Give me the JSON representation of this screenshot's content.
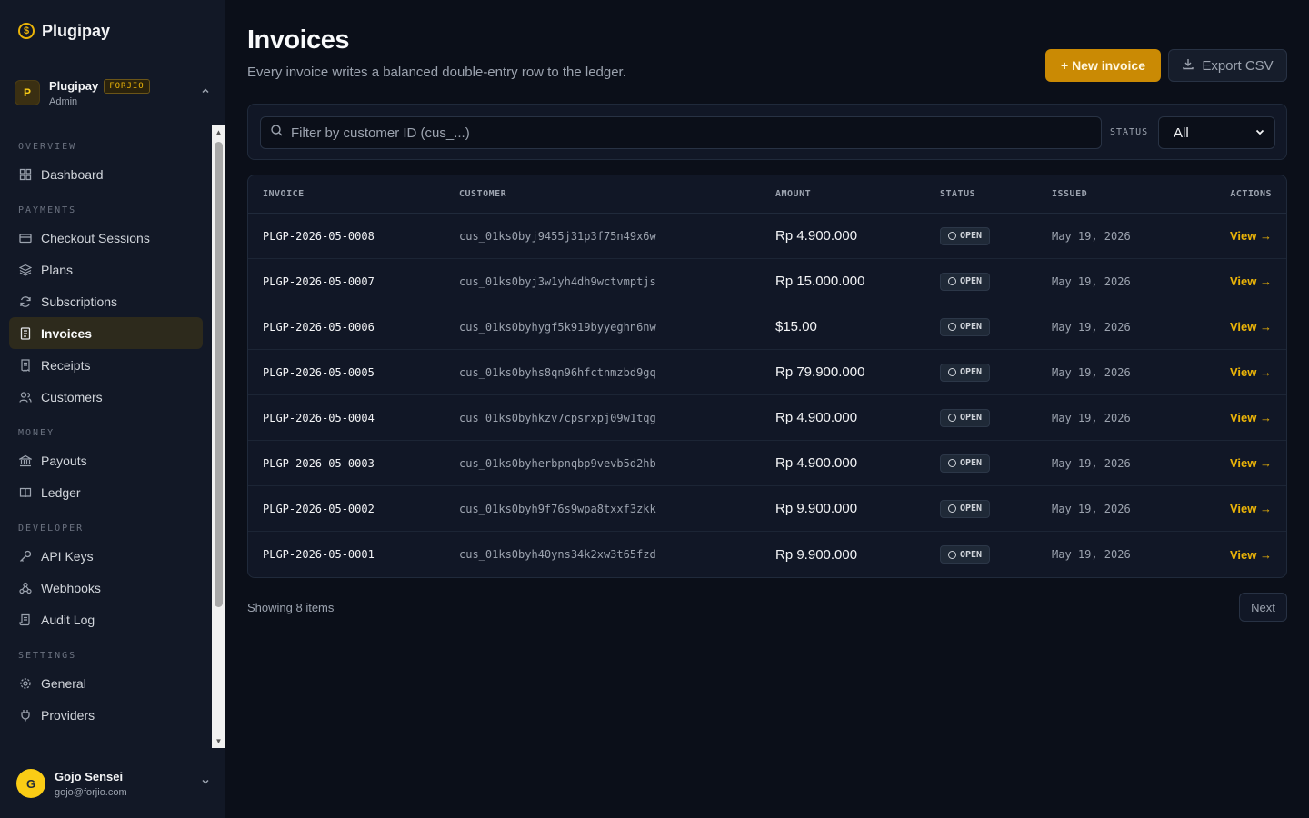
{
  "brand": {
    "name": "Plugipay",
    "logo_glyph": "$"
  },
  "org": {
    "initial": "P",
    "name": "Plugipay",
    "tag": "FORJIO",
    "role": "Admin"
  },
  "nav": {
    "sections": [
      {
        "title": "OVERVIEW",
        "items": [
          {
            "label": "Dashboard",
            "icon": "grid-icon"
          }
        ]
      },
      {
        "title": "PAYMENTS",
        "items": [
          {
            "label": "Checkout Sessions",
            "icon": "card-icon"
          },
          {
            "label": "Plans",
            "icon": "layers-icon"
          },
          {
            "label": "Subscriptions",
            "icon": "refresh-icon"
          },
          {
            "label": "Invoices",
            "icon": "invoice-icon",
            "active": true
          },
          {
            "label": "Receipts",
            "icon": "receipt-icon"
          },
          {
            "label": "Customers",
            "icon": "users-icon"
          }
        ]
      },
      {
        "title": "MONEY",
        "items": [
          {
            "label": "Payouts",
            "icon": "bank-icon"
          },
          {
            "label": "Ledger",
            "icon": "book-icon"
          }
        ]
      },
      {
        "title": "DEVELOPER",
        "items": [
          {
            "label": "API Keys",
            "icon": "key-icon"
          },
          {
            "label": "Webhooks",
            "icon": "webhook-icon"
          },
          {
            "label": "Audit Log",
            "icon": "scroll-icon"
          }
        ]
      },
      {
        "title": "SETTINGS",
        "items": [
          {
            "label": "General",
            "icon": "gear-icon"
          },
          {
            "label": "Providers",
            "icon": "plug-icon"
          }
        ]
      }
    ]
  },
  "user": {
    "initial": "G",
    "name": "Gojo Sensei",
    "email": "gojo@forjio.com"
  },
  "header": {
    "title": "Invoices",
    "subtitle": "Every invoice writes a balanced double-entry row to the ledger.",
    "new_label": "+ New invoice",
    "export_label": "Export CSV"
  },
  "filter": {
    "placeholder": "Filter by customer ID (cus_...)",
    "status_label": "STATUS",
    "status_value": "All"
  },
  "table": {
    "columns": [
      "INVOICE",
      "CUSTOMER",
      "AMOUNT",
      "STATUS",
      "ISSUED",
      "ACTIONS"
    ],
    "rows": [
      {
        "invoice": "PLGP-2026-05-0008",
        "customer": "cus_01ks0byj9455j31p3f75n49x6w",
        "amount": "Rp 4.900.000",
        "status": "OPEN",
        "issued": "May 19, 2026",
        "action": "View →"
      },
      {
        "invoice": "PLGP-2026-05-0007",
        "customer": "cus_01ks0byj3w1yh4dh9wctvmptjs",
        "amount": "Rp 15.000.000",
        "status": "OPEN",
        "issued": "May 19, 2026",
        "action": "View →"
      },
      {
        "invoice": "PLGP-2026-05-0006",
        "customer": "cus_01ks0byhygf5k919byyeghn6nw",
        "amount": "$15.00",
        "status": "OPEN",
        "issued": "May 19, 2026",
        "action": "View →"
      },
      {
        "invoice": "PLGP-2026-05-0005",
        "customer": "cus_01ks0byhs8qn96hfctnmzbd9gq",
        "amount": "Rp 79.900.000",
        "status": "OPEN",
        "issued": "May 19, 2026",
        "action": "View →"
      },
      {
        "invoice": "PLGP-2026-05-0004",
        "customer": "cus_01ks0byhkzv7cpsrxpj09w1tqg",
        "amount": "Rp 4.900.000",
        "status": "OPEN",
        "issued": "May 19, 2026",
        "action": "View →"
      },
      {
        "invoice": "PLGP-2026-05-0003",
        "customer": "cus_01ks0byherbpnqbp9vevb5d2hb",
        "amount": "Rp 4.900.000",
        "status": "OPEN",
        "issued": "May 19, 2026",
        "action": "View →"
      },
      {
        "invoice": "PLGP-2026-05-0002",
        "customer": "cus_01ks0byh9f76s9wpa8txxf3zkk",
        "amount": "Rp 9.900.000",
        "status": "OPEN",
        "issued": "May 19, 2026",
        "action": "View →"
      },
      {
        "invoice": "PLGP-2026-05-0001",
        "customer": "cus_01ks0byh40yns34k2xw3t65fzd",
        "amount": "Rp 9.900.000",
        "status": "OPEN",
        "issued": "May 19, 2026",
        "action": "View →"
      }
    ]
  },
  "footer": {
    "showing": "Showing 8 items",
    "next_label": "Next"
  },
  "colors": {
    "accent": "#ca8a04",
    "link": "#eab308",
    "background": "#0b0f19",
    "sidebar": "#121826"
  }
}
